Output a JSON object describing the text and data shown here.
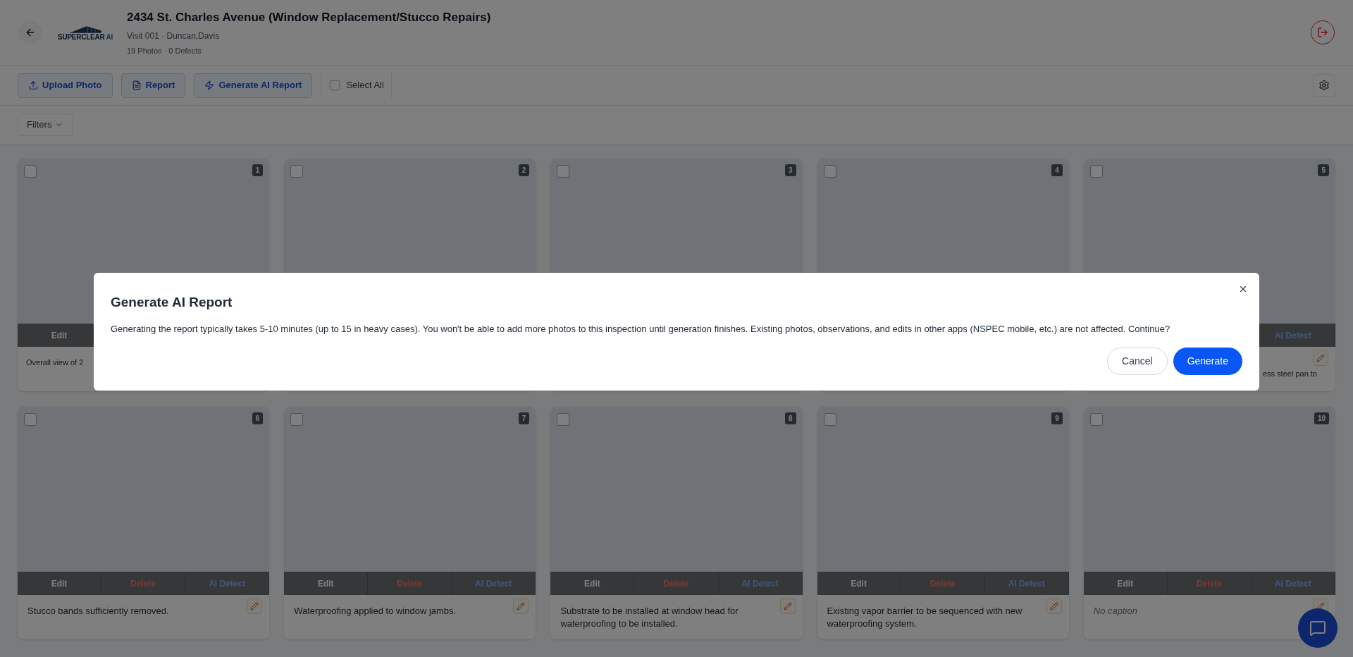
{
  "header": {
    "logo": {
      "name": "SUPERCLEAR",
      "suffix": "AI"
    },
    "title": "2434 St. Charles Avenue (Window Replacement/Stucco Repairs)",
    "subtitle": "Visit 001 · Duncan,Davis",
    "stats": "19 Photos · 0 Defects"
  },
  "toolbar": {
    "buttons": [
      {
        "label": "Upload Photo",
        "kind": "upload"
      },
      {
        "label": "Report",
        "kind": "report"
      },
      {
        "label": "Generate AI Report",
        "kind": "generate"
      }
    ],
    "select_all": {
      "label": "Select All",
      "checked": false
    }
  },
  "filters": {
    "label": "Filters"
  },
  "photos": [
    {
      "number": "1",
      "checked": false,
      "actions": [
        {
          "label": "Edit",
          "kind": "edit"
        }
      ],
      "caption": {
        "text": "Overall view of 2",
        "clipped_right": true
      }
    },
    {
      "number": "2",
      "checked": false
    },
    {
      "number": "3",
      "checked": false
    },
    {
      "number": "4",
      "checked": false
    },
    {
      "number": "5",
      "checked": false,
      "actions": [
        {
          "label": "AI Detect",
          "kind": "detect"
        }
      ],
      "caption": {
        "text": "ess steel pan to",
        "clipped_left": true
      },
      "edit_caption": true
    },
    {
      "number": "6",
      "checked": false,
      "actions": [
        {
          "label": "Edit",
          "kind": "edit"
        },
        {
          "label": "Delete",
          "kind": "delete"
        },
        {
          "label": "AI Detect",
          "kind": "detect"
        }
      ],
      "caption": {
        "text": "Stucco bands sufficiently removed."
      },
      "edit_caption": true
    },
    {
      "number": "7",
      "checked": false,
      "actions": [
        {
          "label": "Edit",
          "kind": "edit"
        },
        {
          "label": "Delete",
          "kind": "delete"
        },
        {
          "label": "AI Detect",
          "kind": "detect"
        }
      ],
      "caption": {
        "text": "Waterproofing applied to window jambs."
      },
      "edit_caption": true
    },
    {
      "number": "8",
      "checked": false,
      "actions": [
        {
          "label": "Edit",
          "kind": "edit"
        },
        {
          "label": "Delete",
          "kind": "delete"
        },
        {
          "label": "AI Detect",
          "kind": "detect"
        }
      ],
      "caption": {
        "text": "Substrate to be installed at window head for waterproofing to be installed."
      },
      "edit_caption": true
    },
    {
      "number": "9",
      "checked": false,
      "actions": [
        {
          "label": "Edit",
          "kind": "edit"
        },
        {
          "label": "Delete",
          "kind": "delete"
        },
        {
          "label": "AI Detect",
          "kind": "detect"
        }
      ],
      "caption": {
        "text": "Existing vapor barrier to be sequenced with new waterproofing system."
      },
      "edit_caption": true
    },
    {
      "number": "10",
      "checked": false,
      "actions": [
        {
          "label": "Edit",
          "kind": "edit"
        },
        {
          "label": "Delete",
          "kind": "delete"
        },
        {
          "label": "AI Detect",
          "kind": "detect"
        }
      ],
      "caption": {
        "text": "No caption",
        "empty": true
      },
      "edit_caption": true
    }
  ],
  "dialog": {
    "title": "Generate AI Report",
    "message": "Generating the report typically takes 5-10 minutes (up to 15 in heavy cases). You won't be able to add more photos to this inspection until generation finishes. Existing photos, observations, and edits in other apps (NSPEC mobile, etc.) are not affected. Continue?",
    "buttons": [
      {
        "label": "Cancel",
        "kind": "secondary"
      },
      {
        "label": "Generate",
        "kind": "primary"
      }
    ]
  }
}
